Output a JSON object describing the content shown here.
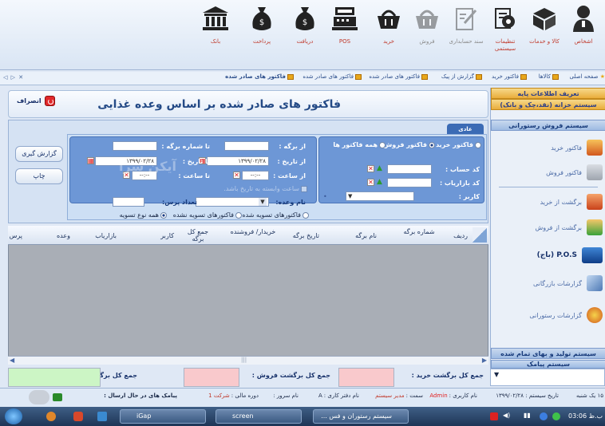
{
  "toolbar": {
    "items": [
      {
        "label": "اشخاص",
        "icon": "person-icon",
        "enabled": true
      },
      {
        "label": "کالا و خدمات",
        "icon": "box-icon",
        "enabled": true
      },
      {
        "label": "تنظیمات سیستمی",
        "icon": "settings-icon",
        "enabled": true
      },
      {
        "label": "سند حسابداری",
        "icon": "document-icon",
        "enabled": false
      },
      {
        "label": "فروش",
        "icon": "basket-icon",
        "enabled": false
      },
      {
        "label": "خرید",
        "icon": "basket-icon",
        "enabled": true
      },
      {
        "label": "POS",
        "icon": "cash-register-icon",
        "enabled": true
      },
      {
        "label": "دریافت",
        "icon": "money-bag-icon",
        "enabled": true
      },
      {
        "label": "پرداخت",
        "icon": "money-bag-icon",
        "enabled": true
      },
      {
        "label": "بانک",
        "icon": "bank-icon",
        "enabled": true
      }
    ]
  },
  "tabs": {
    "controls": "◁ ▷ ✕",
    "items": [
      "صفحه اصلی",
      "کالاها",
      "فاکتور خرید",
      "گزارش از پیک",
      "فاکتور های صادر شده",
      "فاکتور های صادر شده",
      "فاکتور های صادر شده"
    ]
  },
  "form": {
    "title": "فاکتور های صادر شده بر اساس وعده غذایی",
    "exit_label": "انصراف",
    "report_button": "گزارش گیری",
    "print_button": "چاپ",
    "filter_tab": "عادی"
  },
  "filters": {
    "invoice_type": {
      "options": [
        "فاکتور خرید",
        "فاکتور فروش",
        "همه فاکتور ها"
      ],
      "selected": "فاکتور فروش"
    },
    "account_code_label": "کد حساب :",
    "marketer_code_label": "کد بازاریاب :",
    "user_label": "کاربر :",
    "from_page_label": "از برگه :",
    "to_page_label": "تا شماره برگه :",
    "from_date_label": "از تاریخ :",
    "from_date": "۱۳۹۹/۰۲/۲۸",
    "to_date_label": "تا تاریخ :",
    "to_date": "۱۳۹۹/۰۲/۲۸",
    "from_time_label": "از ساعت :",
    "from_time": "--:--",
    "to_time_label": "تا ساعت :",
    "to_time": "--:--",
    "time_dep_label": "ساعت وابسته به تاریخ باشد.",
    "meal_label": "نام وعده:",
    "count_label": "تعداد پرس:",
    "settle": {
      "options": [
        "فاکتورهای تسویه شده",
        "فاکتورهای تسویه نشده",
        "همه نوع تسویه"
      ],
      "selected": "همه نوع تسویه"
    },
    "watermark": "آیکن سرا"
  },
  "grid": {
    "columns": [
      "ردیف",
      "شماره برگه",
      "نام برگه",
      "تاریخ برگه",
      "خریدار/ فروشنده",
      "جمع کل برگه",
      "کاربر",
      "بازاریاب",
      "وعده",
      "پرس"
    ],
    "scroll_mark": "|||"
  },
  "totals": {
    "buy_return_label": "جمع کل برگشت خرید :",
    "sale_return_label": "جمع کل برگشت فروش :",
    "sheet_total_label": "جمع کل برگه :"
  },
  "nav": {
    "headers": [
      "تعریف اطلاعات پایه",
      "سیستم خزانه (نقد،چک و بانک)",
      "سیستم فروش رستورانی"
    ],
    "items": [
      {
        "label": "فاکتور خرید",
        "bold": false
      },
      {
        "label": "فاکتور فروش",
        "bold": false
      },
      {
        "label": "برگشت از خرید",
        "bold": false
      },
      {
        "label": "برگشت از فروش",
        "bold": false
      },
      {
        "label": "P.O.S (باج)",
        "bold": true
      },
      {
        "label": "گزارشات بازرگانی",
        "bold": false
      },
      {
        "label": "گزارشات رستورانی",
        "bold": false
      }
    ],
    "footers": [
      "سیستم تولید و بهای تمام شده",
      "سیستم پیامک"
    ]
  },
  "status": {
    "date": "۱۵ یک شنبه",
    "system_date": "تاریخ سیستم : ۱۳۹۹/۰۲/۲۸",
    "username_label": "نام کاربری :",
    "username": "Admin",
    "role_label": "سمت :",
    "role": "مدیر سیستم",
    "office_label": "نام دفتر کاری :",
    "office": "A",
    "server_label": "نام سرور :",
    "period_label": "دوره مالی :",
    "company": "شرکت 1",
    "sms_status": "پیامک های در حال ارسال :"
  },
  "taskbar": {
    "tasks": [
      "iGap",
      "screen",
      "سیستم رستوران و فس ..."
    ],
    "clock": "03:06 ب.ظ"
  }
}
